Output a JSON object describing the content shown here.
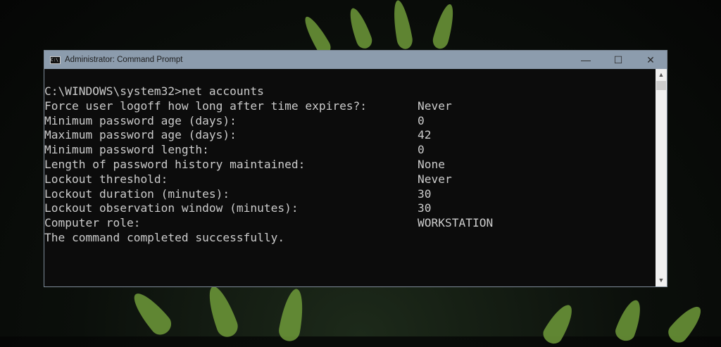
{
  "window": {
    "title": "Administrator: Command Prompt",
    "controls": {
      "minimize": "—",
      "maximize": "☐",
      "close": "✕"
    }
  },
  "console": {
    "prompt": "C:\\WINDOWS\\system32>net accounts",
    "rows": [
      {
        "key": "Force user logoff how long after time expires?:",
        "value": "Never"
      },
      {
        "key": "Minimum password age (days):",
        "value": "0"
      },
      {
        "key": "Maximum password age (days):",
        "value": "42"
      },
      {
        "key": "Minimum password length:",
        "value": "0"
      },
      {
        "key": "Length of password history maintained:",
        "value": "None"
      },
      {
        "key": "Lockout threshold:",
        "value": "Never"
      },
      {
        "key": "Lockout duration (minutes):",
        "value": "30"
      },
      {
        "key": "Lockout observation window (minutes):",
        "value": "30"
      },
      {
        "key": "Computer role:",
        "value": "WORKSTATION"
      }
    ],
    "result": "The command completed successfully."
  },
  "scrollbar": {
    "up": "▲",
    "down": "▼"
  }
}
